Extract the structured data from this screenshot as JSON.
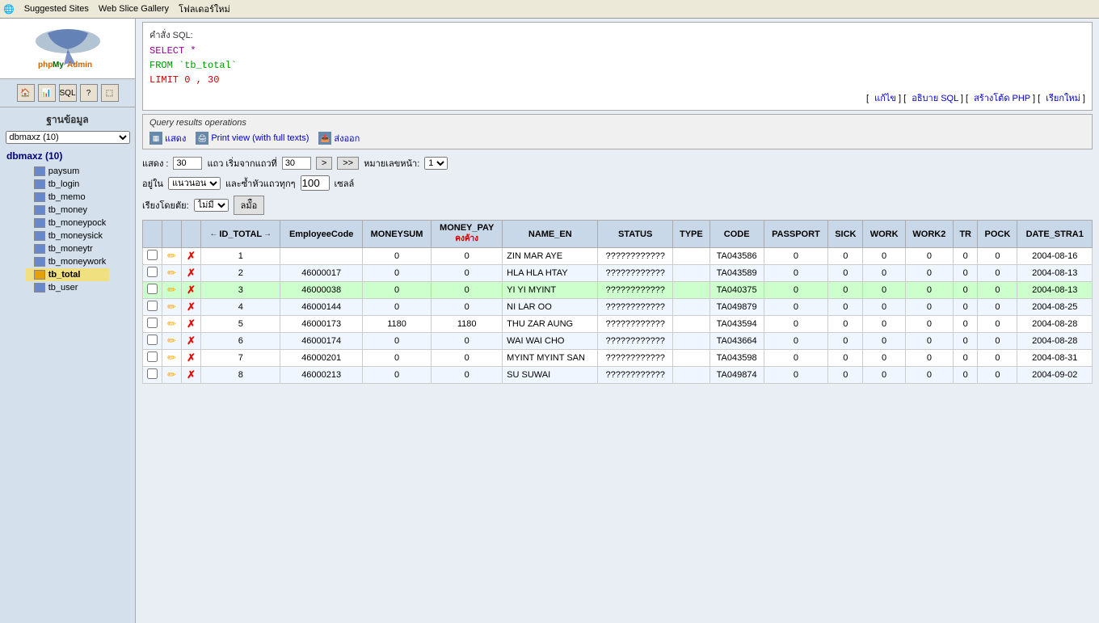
{
  "browser": {
    "tabs": [
      "Suggested Sites",
      "Web Slice Gallery",
      "โฟลเดอร์ใหม่"
    ]
  },
  "sidebar": {
    "db_label": "ฐานข้อมูล",
    "db_select_value": "dbmaxz (10)",
    "db_name": "dbmaxz (10)",
    "nav_items": [
      {
        "label": "paysum",
        "active": false
      },
      {
        "label": "tb_login",
        "active": false
      },
      {
        "label": "tb_memo",
        "active": false
      },
      {
        "label": "tb_money",
        "active": false
      },
      {
        "label": "tb_moneypock",
        "active": false
      },
      {
        "label": "tb_moneysick",
        "active": false
      },
      {
        "label": "tb_moneytr",
        "active": false
      },
      {
        "label": "tb_moneywork",
        "active": false
      },
      {
        "label": "tb_total",
        "active": true
      },
      {
        "label": "tb_user",
        "active": false
      }
    ]
  },
  "sql_section": {
    "label": "คำสั่ง SQL:",
    "line1": "SELECT *",
    "line2": "FROM `tb_total`",
    "line3": "LIMIT 0 , 30",
    "links": [
      "แก้ไข",
      "อธิบาย SQL",
      "สร้างโต้ด PHP",
      "เรียกใหม่"
    ]
  },
  "ops": {
    "label": "Query results operations",
    "buttons": [
      "แสดง",
      "Print view (with full texts)",
      "ส่งออก"
    ]
  },
  "controls": {
    "show_label": "แสดง :",
    "show_value": "30",
    "from_label": "แถว เริ่มจากแถวที่",
    "from_value": "30",
    "nav_next": ">",
    "nav_last": ">>",
    "page_label": "หมายเลขหน้า:",
    "page_value": "1",
    "location_label": "อยู่ใน",
    "location_value": "แนวนอน",
    "repeat_label": "และซ้ำหัวแถวทุกๆ",
    "repeat_value": "100",
    "repeat_unit": "เซลล์",
    "sort_label": "เรียงโดยตัย:",
    "sort_value": "ไม่มี",
    "sort_btn": "ลมัือ"
  },
  "table": {
    "headers": [
      "",
      "",
      "",
      "ID_TOTAL",
      "EmployeeCode",
      "MONEYSUM",
      "MONEY_PAY คงค้าง",
      "NAME_EN",
      "STATUS",
      "TYPE",
      "CODE",
      "PASSPORT",
      "SICK",
      "WORK",
      "WORK2",
      "TR",
      "POCK",
      "DATE_STRA1"
    ],
    "rows": [
      {
        "id": 1,
        "empcode": "",
        "moneysum": 0,
        "moneypay": 0,
        "name": "ZIN MAR AYE",
        "status": "????????????",
        "type": "",
        "code": "TA043586",
        "passport": 0,
        "sick": 0,
        "work": 0,
        "work2": 0,
        "tr": 0,
        "pock": 0,
        "date": "2004-08-16",
        "highlight": false
      },
      {
        "id": 2,
        "empcode": "46000017",
        "moneysum": 0,
        "moneypay": 0,
        "name": "HLA HLA HTAY",
        "status": "????????????",
        "type": "",
        "code": "TA043589",
        "passport": 0,
        "sick": 0,
        "work": 0,
        "work2": 0,
        "tr": 0,
        "pock": 0,
        "date": "2004-08-13",
        "highlight": false
      },
      {
        "id": 3,
        "empcode": "46000038",
        "moneysum": 0,
        "moneypay": 0,
        "name": "YI YI MYINT",
        "status": "????????????",
        "type": "",
        "code": "TA040375",
        "passport": 0,
        "sick": 0,
        "work": 0,
        "work2": 0,
        "tr": 0,
        "pock": 0,
        "date": "2004-08-13",
        "highlight": true
      },
      {
        "id": 4,
        "empcode": "46000144",
        "moneysum": 0,
        "moneypay": 0,
        "name": "NI LAR OO",
        "status": "????????????",
        "type": "",
        "code": "TA049879",
        "passport": 0,
        "sick": 0,
        "work": 0,
        "work2": 0,
        "tr": 0,
        "pock": 0,
        "date": "2004-08-25",
        "highlight": false
      },
      {
        "id": 5,
        "empcode": "46000173",
        "moneysum": 1180,
        "moneypay": 1180,
        "name": "THU ZAR AUNG",
        "status": "????????????",
        "type": "",
        "code": "TA043594",
        "passport": 0,
        "sick": 0,
        "work": 0,
        "work2": 0,
        "tr": 0,
        "pock": 0,
        "date": "2004-08-28",
        "highlight": false
      },
      {
        "id": 6,
        "empcode": "46000174",
        "moneysum": 0,
        "moneypay": 0,
        "name": "WAI WAI CHO",
        "status": "????????????",
        "type": "",
        "code": "TA043664",
        "passport": 0,
        "sick": 0,
        "work": 0,
        "work2": 0,
        "tr": 0,
        "pock": 0,
        "date": "2004-08-28",
        "highlight": false
      },
      {
        "id": 7,
        "empcode": "46000201",
        "moneysum": 0,
        "moneypay": 0,
        "name": "MYINT MYINT SAN",
        "status": "????????????",
        "type": "",
        "code": "TA043598",
        "passport": 0,
        "sick": 0,
        "work": 0,
        "work2": 0,
        "tr": 0,
        "pock": 0,
        "date": "2004-08-31",
        "highlight": false
      },
      {
        "id": 8,
        "empcode": "46000213",
        "moneysum": 0,
        "moneypay": 0,
        "name": "SU SUWAI",
        "status": "????????????",
        "type": "",
        "code": "TA049874",
        "passport": 0,
        "sick": 0,
        "work": 0,
        "work2": 0,
        "tr": 0,
        "pock": 0,
        "date": "2004-09-02",
        "highlight": false
      }
    ]
  }
}
